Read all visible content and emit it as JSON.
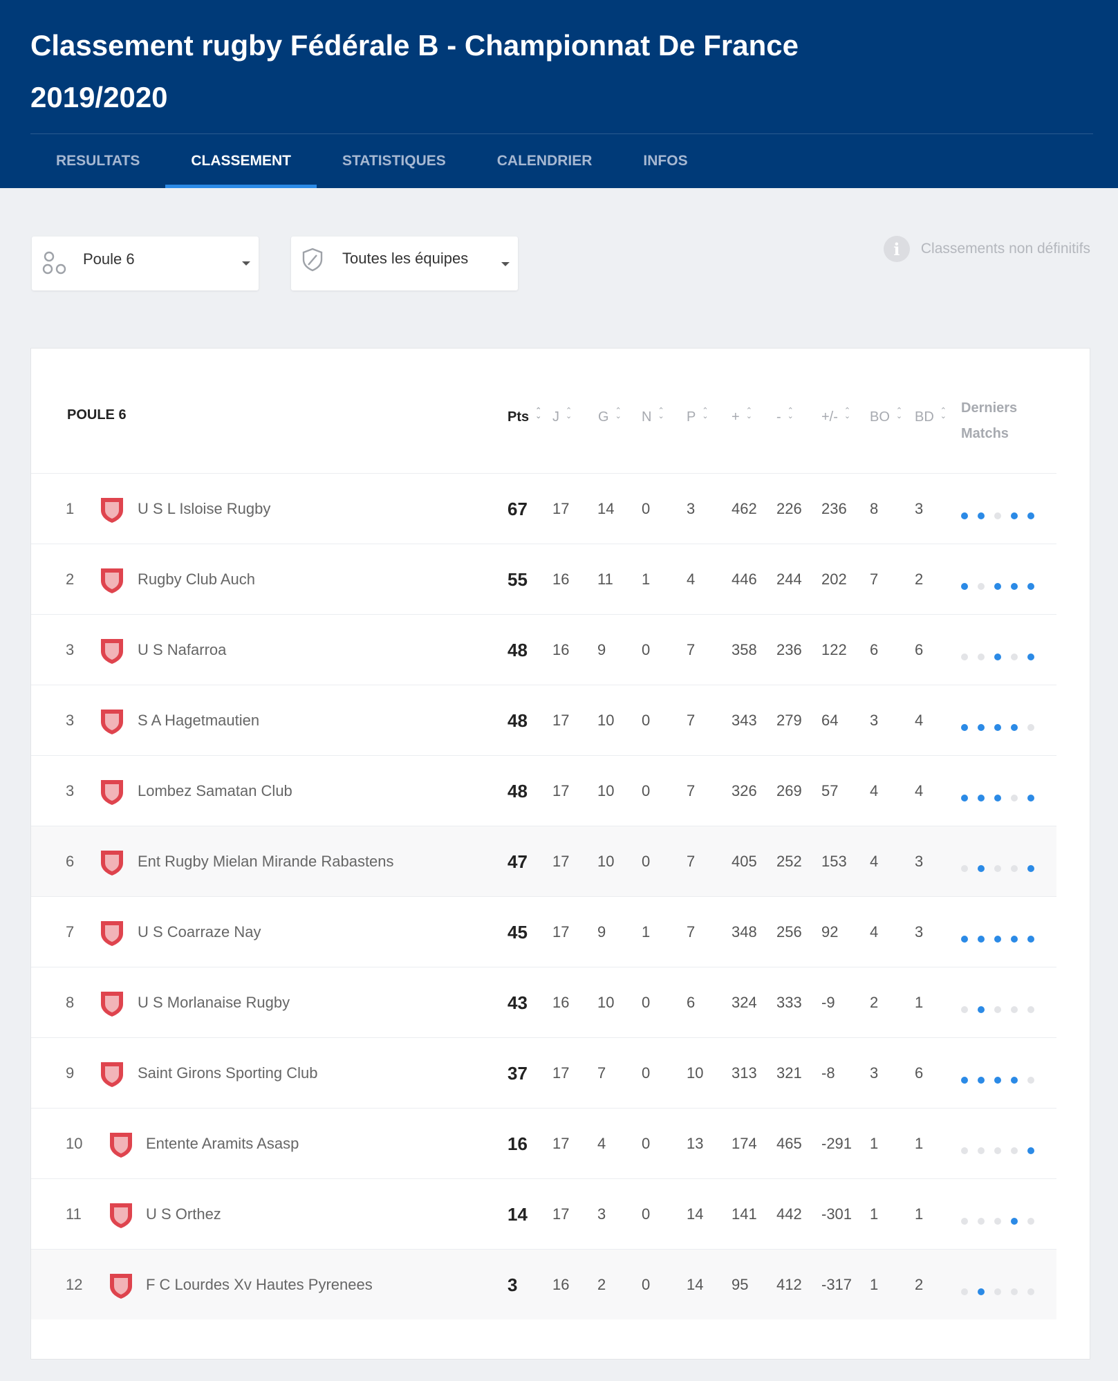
{
  "header": {
    "title": "Classement rugby Fédérale B - Championnat De France 2019/2020",
    "tabs": [
      {
        "label": "RESULTATS",
        "active": false
      },
      {
        "label": "CLASSEMENT",
        "active": true
      },
      {
        "label": "STATISTIQUES",
        "active": false
      },
      {
        "label": "CALENDRIER",
        "active": false
      },
      {
        "label": "INFOS",
        "active": false
      }
    ]
  },
  "filters": {
    "pool_select": {
      "value": "Poule 6",
      "icon": "circles-icon"
    },
    "team_select": {
      "value": "Toutes les équipes",
      "icon": "shield-icon"
    },
    "notice": "Classements non définitifs"
  },
  "standings": {
    "pool_title": "POULE 6",
    "columns": [
      "Pts",
      "J",
      "G",
      "N",
      "P",
      "+",
      "-",
      "+/-",
      "BO",
      "BD",
      "Derniers Matchs"
    ],
    "last_matches_line1": "Derniers",
    "last_matches_line2": "Matchs",
    "rows": [
      {
        "rank": "1",
        "team": "U S L Isloise Rugby",
        "pts": "67",
        "j": "17",
        "g": "14",
        "n": "0",
        "p": "3",
        "plus": "462",
        "minus": "226",
        "diff": "236",
        "bo": "8",
        "bd": "3",
        "form": [
          1,
          1,
          0,
          1,
          1
        ]
      },
      {
        "rank": "2",
        "team": "Rugby Club Auch",
        "pts": "55",
        "j": "16",
        "g": "11",
        "n": "1",
        "p": "4",
        "plus": "446",
        "minus": "244",
        "diff": "202",
        "bo": "7",
        "bd": "2",
        "form": [
          1,
          0,
          1,
          1,
          1
        ]
      },
      {
        "rank": "3",
        "team": "U S Nafarroa",
        "pts": "48",
        "j": "16",
        "g": "9",
        "n": "0",
        "p": "7",
        "plus": "358",
        "minus": "236",
        "diff": "122",
        "bo": "6",
        "bd": "6",
        "form": [
          0,
          0,
          1,
          0,
          1
        ]
      },
      {
        "rank": "3",
        "team": "S A Hagetmautien",
        "pts": "48",
        "j": "17",
        "g": "10",
        "n": "0",
        "p": "7",
        "plus": "343",
        "minus": "279",
        "diff": "64",
        "bo": "3",
        "bd": "4",
        "form": [
          1,
          1,
          1,
          1,
          0
        ]
      },
      {
        "rank": "3",
        "team": "Lombez Samatan Club",
        "pts": "48",
        "j": "17",
        "g": "10",
        "n": "0",
        "p": "7",
        "plus": "326",
        "minus": "269",
        "diff": "57",
        "bo": "4",
        "bd": "4",
        "form": [
          1,
          1,
          1,
          0,
          1
        ]
      },
      {
        "rank": "6",
        "team": "Ent Rugby Mielan Mirande Rabastens",
        "pts": "47",
        "j": "17",
        "g": "10",
        "n": "0",
        "p": "7",
        "plus": "405",
        "minus": "252",
        "diff": "153",
        "bo": "4",
        "bd": "3",
        "form": [
          0,
          1,
          0,
          0,
          1
        ]
      },
      {
        "rank": "7",
        "team": "U S Coarraze Nay",
        "pts": "45",
        "j": "17",
        "g": "9",
        "n": "1",
        "p": "7",
        "plus": "348",
        "minus": "256",
        "diff": "92",
        "bo": "4",
        "bd": "3",
        "form": [
          1,
          1,
          1,
          1,
          1
        ]
      },
      {
        "rank": "8",
        "team": "U S Morlanaise Rugby",
        "pts": "43",
        "j": "16",
        "g": "10",
        "n": "0",
        "p": "6",
        "plus": "324",
        "minus": "333",
        "diff": "-9",
        "bo": "2",
        "bd": "1",
        "form": [
          0,
          1,
          0,
          0,
          0
        ]
      },
      {
        "rank": "9",
        "team": "Saint Girons Sporting Club",
        "pts": "37",
        "j": "17",
        "g": "7",
        "n": "0",
        "p": "10",
        "plus": "313",
        "minus": "321",
        "diff": "-8",
        "bo": "3",
        "bd": "6",
        "form": [
          1,
          1,
          1,
          1,
          0
        ]
      },
      {
        "rank": "10",
        "team": "Entente Aramits Asasp",
        "pts": "16",
        "j": "17",
        "g": "4",
        "n": "0",
        "p": "13",
        "plus": "174",
        "minus": "465",
        "diff": "-291",
        "bo": "1",
        "bd": "1",
        "form": [
          0,
          0,
          0,
          0,
          1
        ]
      },
      {
        "rank": "11",
        "team": "U S Orthez",
        "pts": "14",
        "j": "17",
        "g": "3",
        "n": "0",
        "p": "14",
        "plus": "141",
        "minus": "442",
        "diff": "-301",
        "bo": "1",
        "bd": "1",
        "form": [
          0,
          0,
          0,
          1,
          0
        ]
      },
      {
        "rank": "12",
        "team": "F C Lourdes Xv Hautes Pyrenees",
        "pts": "3",
        "j": "16",
        "g": "2",
        "n": "0",
        "p": "14",
        "plus": "95",
        "minus": "412",
        "diff": "-317",
        "bo": "1",
        "bd": "2",
        "form": [
          0,
          1,
          0,
          0,
          0
        ]
      }
    ]
  },
  "colors": {
    "header_bg": "#003a78",
    "accent": "#2b8ae6",
    "form_win": "#2b8ae6",
    "form_other": "#e3e4e7"
  }
}
